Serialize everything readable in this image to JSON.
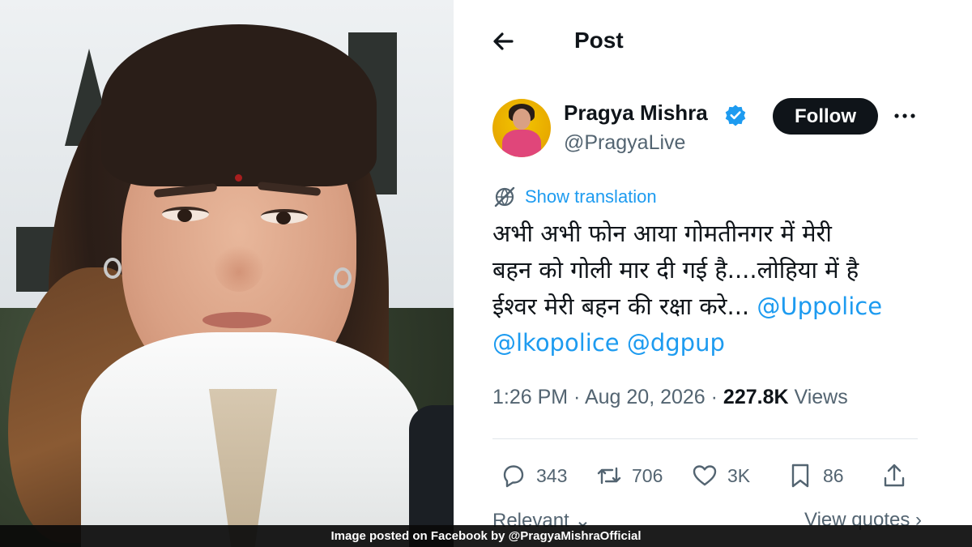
{
  "photo": {
    "alt": "Photo of woman"
  },
  "header": {
    "title": "Post",
    "back_icon": "arrow-left-icon"
  },
  "author": {
    "name": "Pragya Mishra",
    "handle": "@PragyaLive",
    "verified_color": "#1d9bf0",
    "follow_label": "Follow",
    "more_icon": "ellipsis-icon"
  },
  "translation": {
    "label": "Show translation",
    "icon": "globe-icon"
  },
  "tweet": {
    "line1": "अभी अभी फोन आया गोमतीनगर में मेरी",
    "line2": "बहन को गोली मार दी गई है....लोहिया में है",
    "line3_text": "ईश्वर मेरी बहन की रक्षा करे... ",
    "mention1": "@Uppolice",
    "mention2": "@lkopolice",
    "mention3": "@dgpup"
  },
  "meta": {
    "time": "1:26 PM",
    "sep": " · ",
    "date": "Aug 20, 2026",
    "views_count": "227.8K",
    "views_label": " Views"
  },
  "actions": {
    "replies": "343",
    "reposts": "706",
    "likes": "3K",
    "bookmarks": "86"
  },
  "tabs": {
    "relevant": "Relevant",
    "quotes": "View quotes"
  },
  "caption": "Image posted on Facebook by @PragyaMishraOfficial",
  "colors": {
    "accent": "#1d9bf0",
    "text": "#0f1419",
    "muted": "#536471"
  }
}
